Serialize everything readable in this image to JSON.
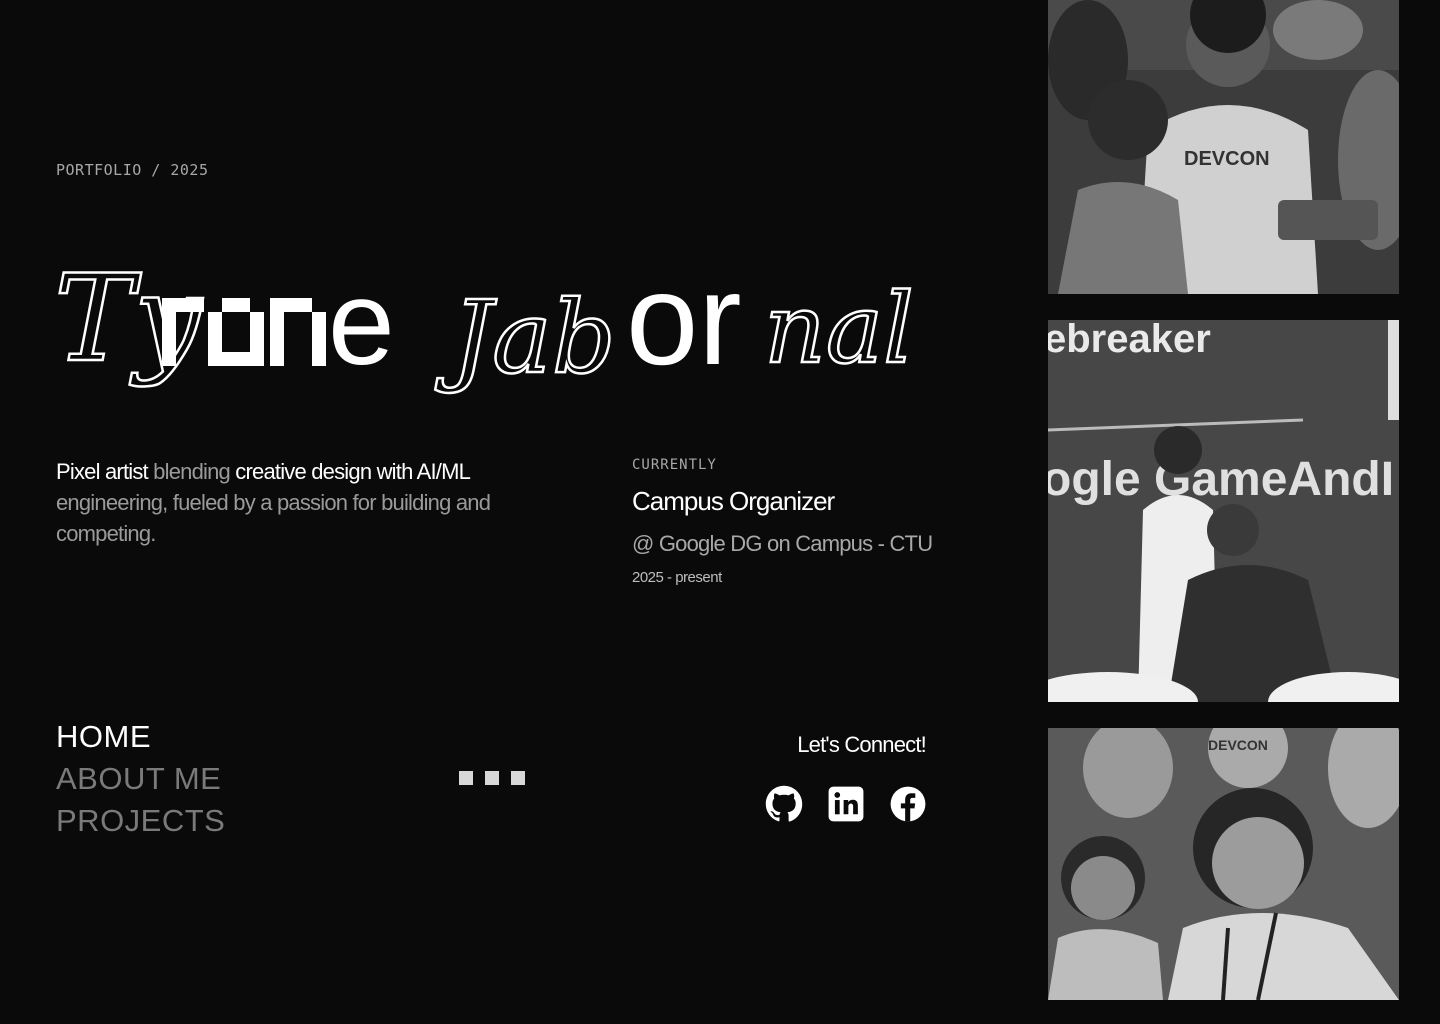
{
  "header": {
    "eyebrow": "PORTFOLIO / 2025"
  },
  "hero": {
    "name_parts": [
      "Ty",
      "r",
      "on",
      "e",
      "Jab",
      "or",
      "nal"
    ]
  },
  "bio": {
    "part1": "Pixel artist",
    "part2": " blending ",
    "part3": "creative design with AI/ML",
    "part4": " engineering, fueled by a passion for building and competing."
  },
  "current": {
    "label": "CURRENTLY",
    "role": "Campus Organizer",
    "org": "@ Google DG on Campus - CTU",
    "period": "2025 - present"
  },
  "nav": {
    "items": [
      {
        "label": "HOME",
        "active": true
      },
      {
        "label": "ABOUT ME",
        "active": false
      },
      {
        "label": "PROJECTS",
        "active": false
      }
    ]
  },
  "pager": {
    "count": 3
  },
  "connect": {
    "title": "Let's Connect!",
    "socials": [
      {
        "icon": "github-icon"
      },
      {
        "icon": "linkedin-icon"
      },
      {
        "icon": "facebook-icon"
      }
    ]
  },
  "gallery": {
    "photo1_text": "DEVCON",
    "photo2_text_top": "ebreaker",
    "photo2_text_mid": "ogle GameAndI",
    "photo3_text": "DEVCON"
  },
  "colors": {
    "background": "#0a0a0a",
    "text_primary": "#ffffff",
    "text_muted": "#9a9a9a",
    "nav_inactive": "#7a7a7a"
  }
}
